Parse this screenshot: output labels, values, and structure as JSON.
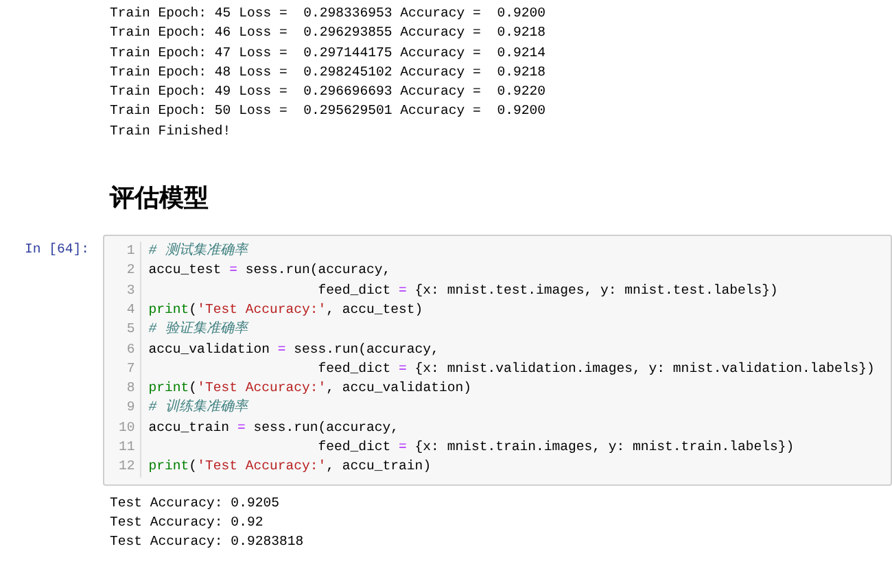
{
  "training_output": {
    "lines": [
      "Train Epoch: 45 Loss =  0.298336953 Accuracy =  0.9200",
      "Train Epoch: 46 Loss =  0.296293855 Accuracy =  0.9218",
      "Train Epoch: 47 Loss =  0.297144175 Accuracy =  0.9214",
      "Train Epoch: 48 Loss =  0.298245102 Accuracy =  0.9218",
      "Train Epoch: 49 Loss =  0.296696693 Accuracy =  0.9220",
      "Train Epoch: 50 Loss =  0.295629501 Accuracy =  0.9200",
      "Train Finished!"
    ]
  },
  "heading": "评估模型",
  "cell": {
    "prompt": "In [64]:",
    "lines": [
      {
        "number": "1",
        "tokens": [
          {
            "kind": "comment",
            "text": "# 测试集准确率"
          }
        ]
      },
      {
        "number": "2",
        "tokens": [
          {
            "kind": "plain",
            "text": "accu_test "
          },
          {
            "kind": "operator",
            "text": "="
          },
          {
            "kind": "plain",
            "text": " sess.run(accuracy,"
          }
        ]
      },
      {
        "number": "3",
        "tokens": [
          {
            "kind": "plain",
            "text": "                     feed_dict "
          },
          {
            "kind": "operator",
            "text": "="
          },
          {
            "kind": "plain",
            "text": " {x: mnist.test.images, y: mnist.test.labels})"
          }
        ]
      },
      {
        "number": "4",
        "tokens": [
          {
            "kind": "builtin",
            "text": "print"
          },
          {
            "kind": "plain",
            "text": "("
          },
          {
            "kind": "string",
            "text": "'Test Accuracy:'"
          },
          {
            "kind": "plain",
            "text": ", accu_test)"
          }
        ]
      },
      {
        "number": "5",
        "tokens": [
          {
            "kind": "comment",
            "text": "# 验证集准确率"
          }
        ]
      },
      {
        "number": "6",
        "tokens": [
          {
            "kind": "plain",
            "text": "accu_validation "
          },
          {
            "kind": "operator",
            "text": "="
          },
          {
            "kind": "plain",
            "text": " sess.run(accuracy,"
          }
        ]
      },
      {
        "number": "7",
        "tokens": [
          {
            "kind": "plain",
            "text": "                     feed_dict "
          },
          {
            "kind": "operator",
            "text": "="
          },
          {
            "kind": "plain",
            "text": " {x: mnist.validation.images, y: mnist.validation.labels})"
          }
        ]
      },
      {
        "number": "8",
        "tokens": [
          {
            "kind": "builtin",
            "text": "print"
          },
          {
            "kind": "plain",
            "text": "("
          },
          {
            "kind": "string",
            "text": "'Test Accuracy:'"
          },
          {
            "kind": "plain",
            "text": ", accu_validation)"
          }
        ]
      },
      {
        "number": "9",
        "tokens": [
          {
            "kind": "comment",
            "text": "# 训练集准确率"
          }
        ]
      },
      {
        "number": "10",
        "tokens": [
          {
            "kind": "plain",
            "text": "accu_train "
          },
          {
            "kind": "operator",
            "text": "="
          },
          {
            "kind": "plain",
            "text": " sess.run(accuracy,"
          }
        ]
      },
      {
        "number": "11",
        "tokens": [
          {
            "kind": "plain",
            "text": "                     feed_dict "
          },
          {
            "kind": "operator",
            "text": "="
          },
          {
            "kind": "plain",
            "text": " {x: mnist.train.images, y: mnist.train.labels})"
          }
        ]
      },
      {
        "number": "12",
        "tokens": [
          {
            "kind": "builtin",
            "text": "print"
          },
          {
            "kind": "plain",
            "text": "("
          },
          {
            "kind": "string",
            "text": "'Test Accuracy:'"
          },
          {
            "kind": "plain",
            "text": ", accu_train)"
          }
        ]
      }
    ]
  },
  "result_output": {
    "lines": [
      "Test Accuracy: 0.9205",
      "Test Accuracy: 0.92",
      "Test Accuracy: 0.9283818"
    ]
  }
}
